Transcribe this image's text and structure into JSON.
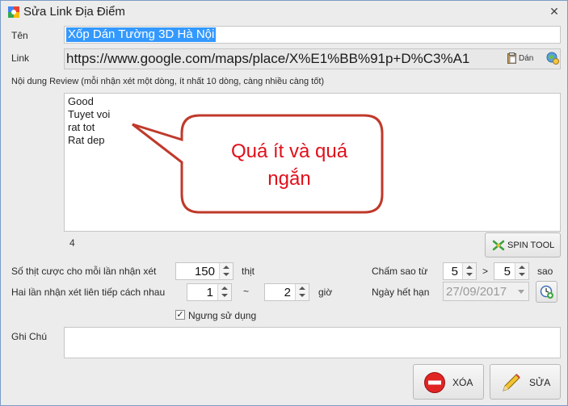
{
  "window": {
    "title": "Sửa Link Địa Điểm",
    "close_glyph": "✕",
    "app_icon": "google-maps-icon"
  },
  "name": {
    "label": "Tên",
    "value": "Xốp Dán Tường 3D Hà Nội"
  },
  "link": {
    "label": "Link",
    "value": "https://www.google.com/maps/place/X%E1%BB%91p+D%C3%A1",
    "paste_label": "Dán",
    "globe_icon": "globe-icon"
  },
  "review": {
    "label": "Nội dung Review (mỗi nhận xét một dòng, ít nhất 10 dòng, càng nhiều càng tốt)",
    "lines": [
      "Good",
      "Tuyet voi",
      "rat tot",
      "Rat dep"
    ],
    "count": "4",
    "annotation_line1": "Quá ít và quá",
    "annotation_line2": "ngắn",
    "annotation_color": "#e0101a"
  },
  "spin_tool": {
    "label": "SPIN TOOL"
  },
  "stars_per": {
    "label": "Số thịt cược cho mỗi lần nhận xét",
    "value": "150",
    "unit": "thịt"
  },
  "interval": {
    "label": "Hai lần nhận xét liên tiếp cách nhau",
    "from": "1",
    "sep": "~",
    "to": "2",
    "unit": "giờ"
  },
  "rating": {
    "label": "Chấm sao từ",
    "from": "5",
    "sep": ">",
    "to": "5",
    "unit": "sao"
  },
  "expiry": {
    "label": "Ngày hết hạn",
    "value": "27/09/2017"
  },
  "stop": {
    "label": "Ngưng sử dụng",
    "checked_glyph": "✓"
  },
  "note": {
    "label": "Ghi Chú",
    "value": ""
  },
  "buttons": {
    "delete": "XÓA",
    "edit": "SỬA"
  }
}
